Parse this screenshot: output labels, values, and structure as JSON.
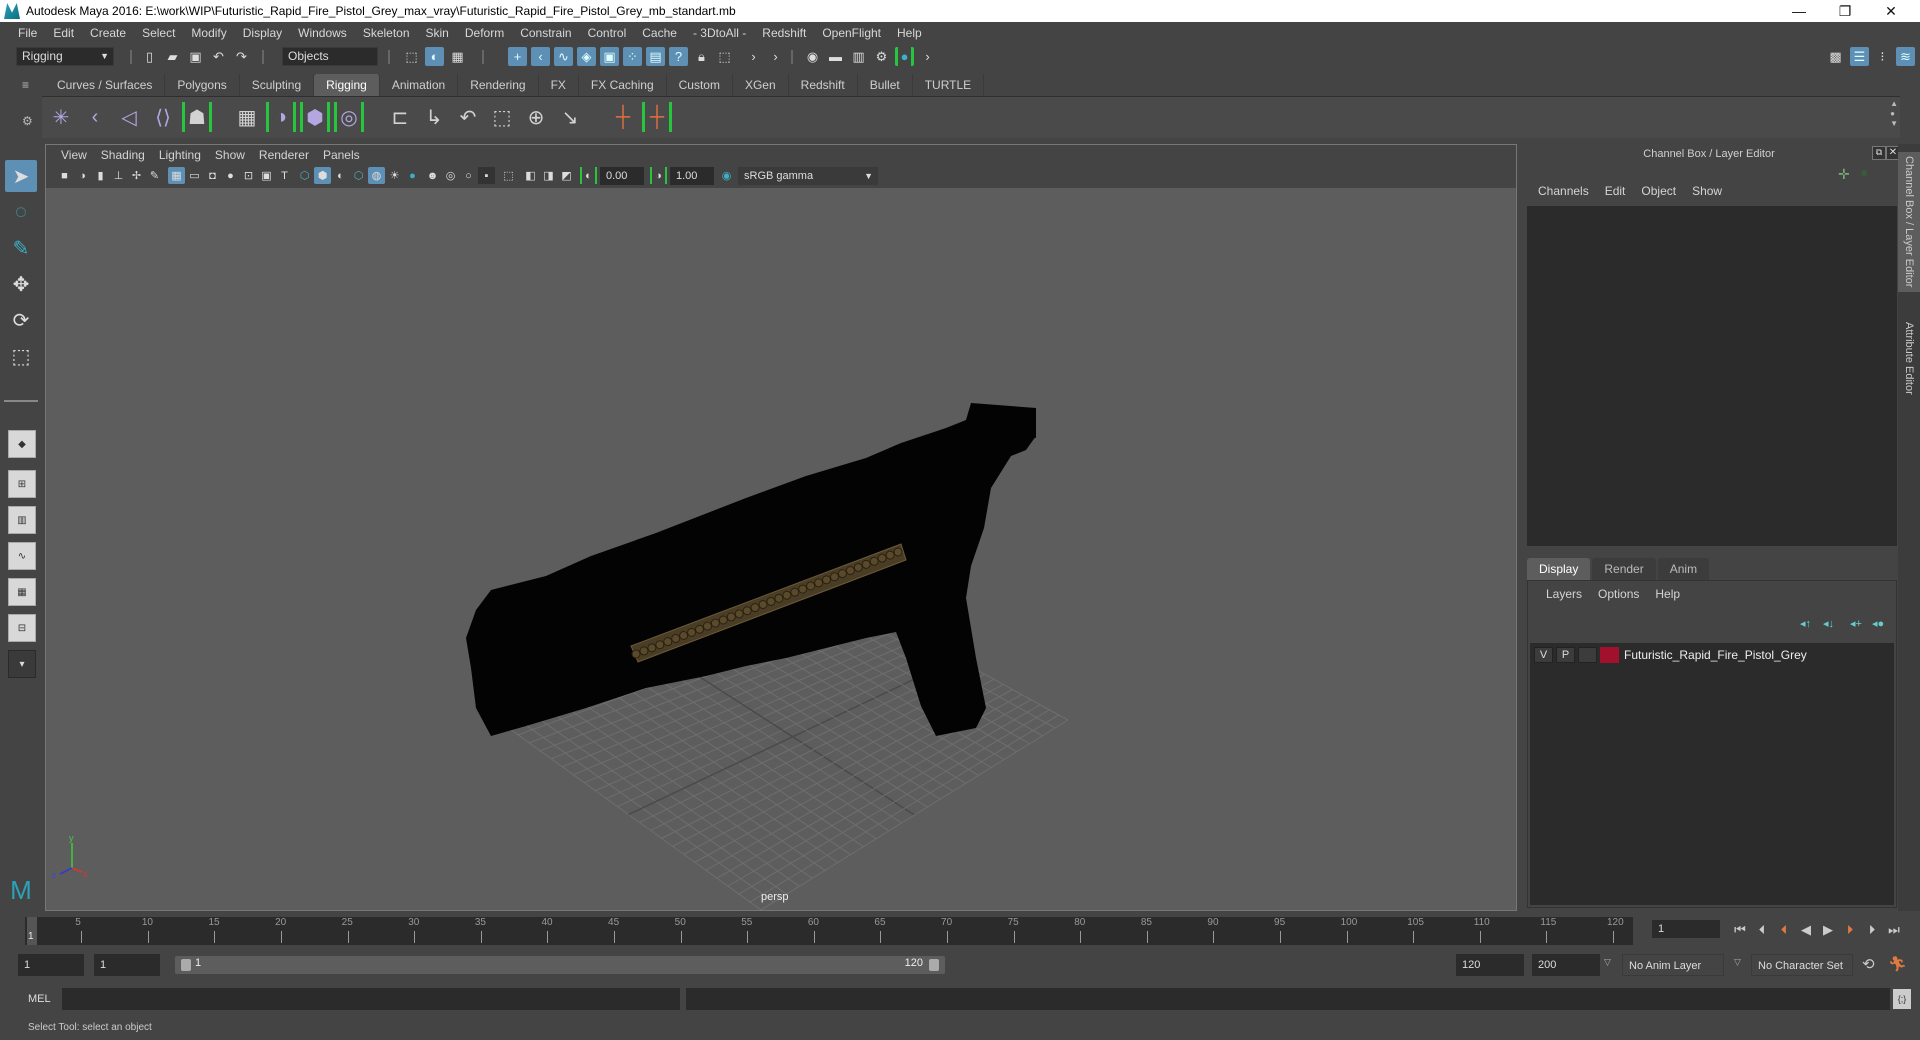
{
  "window": {
    "title": "Autodesk Maya 2016: E:\\work\\WIP\\Futuristic_Rapid_Fire_Pistol_Grey_max_vray\\Futuristic_Rapid_Fire_Pistol_Grey_mb_standart.mb",
    "minimize": "—",
    "restore": "❐",
    "close": "✕"
  },
  "menubar": [
    "File",
    "Edit",
    "Create",
    "Select",
    "Modify",
    "Display",
    "Windows",
    "Skeleton",
    "Skin",
    "Deform",
    "Constrain",
    "Control",
    "Cache",
    "- 3DtoAll -",
    "Redshift",
    "OpenFlight",
    "Help"
  ],
  "statusline": {
    "menuset": "Rigging",
    "selection_mode": "Objects"
  },
  "shelf": {
    "tabs": [
      "Curves / Surfaces",
      "Polygons",
      "Sculpting",
      "Rigging",
      "Animation",
      "Rendering",
      "FX",
      "FX Caching",
      "Custom",
      "XGen",
      "Redshift",
      "Bullet",
      "TURTLE"
    ],
    "active_tab": "Rigging"
  },
  "viewport": {
    "menu": [
      "View",
      "Shading",
      "Lighting",
      "Show",
      "Renderer",
      "Panels"
    ],
    "exposure": "0.00",
    "gamma": "1.00",
    "color_space": "sRGB gamma",
    "camera_label": "persp",
    "axis_labels": {
      "x": "x",
      "y": "y",
      "z": "z"
    }
  },
  "channel_box": {
    "title": "Channel Box / Layer Editor",
    "menu": [
      "Channels",
      "Edit",
      "Object",
      "Show"
    ]
  },
  "layer_editor": {
    "tabs": [
      "Display",
      "Render",
      "Anim"
    ],
    "active_tab": "Display",
    "menu": [
      "Layers",
      "Options",
      "Help"
    ],
    "layers": [
      {
        "visible": "V",
        "playback": "P",
        "name": "Futuristic_Rapid_Fire_Pistol_Grey",
        "color": "#a3102c"
      }
    ]
  },
  "side_tabs": [
    "Channel Box / Layer Editor",
    "Attribute Editor"
  ],
  "time_slider": {
    "ticks": [
      5,
      10,
      15,
      20,
      25,
      30,
      35,
      40,
      45,
      50,
      55,
      60,
      65,
      70,
      75,
      80,
      85,
      90,
      95,
      100,
      105,
      110,
      115,
      120
    ],
    "current_frame_marker": "1",
    "current_frame": "1",
    "min": 1,
    "max": 120
  },
  "range_slider": {
    "start_time": "1",
    "playback_start": "1",
    "range_start_label": "1",
    "range_end_label": "120",
    "playback_end": "120",
    "end_time": "200",
    "anim_layer": "No Anim Layer",
    "character_set": "No Character Set"
  },
  "command_line": {
    "language": "MEL"
  },
  "help_line": "Select Tool: select an object",
  "colors": {
    "accent_blue": "#5e8fb4",
    "shelf_bracket_green": "#27c53e",
    "layer_color": "#a3102c",
    "viewport_bg": "#5d5d5d"
  }
}
